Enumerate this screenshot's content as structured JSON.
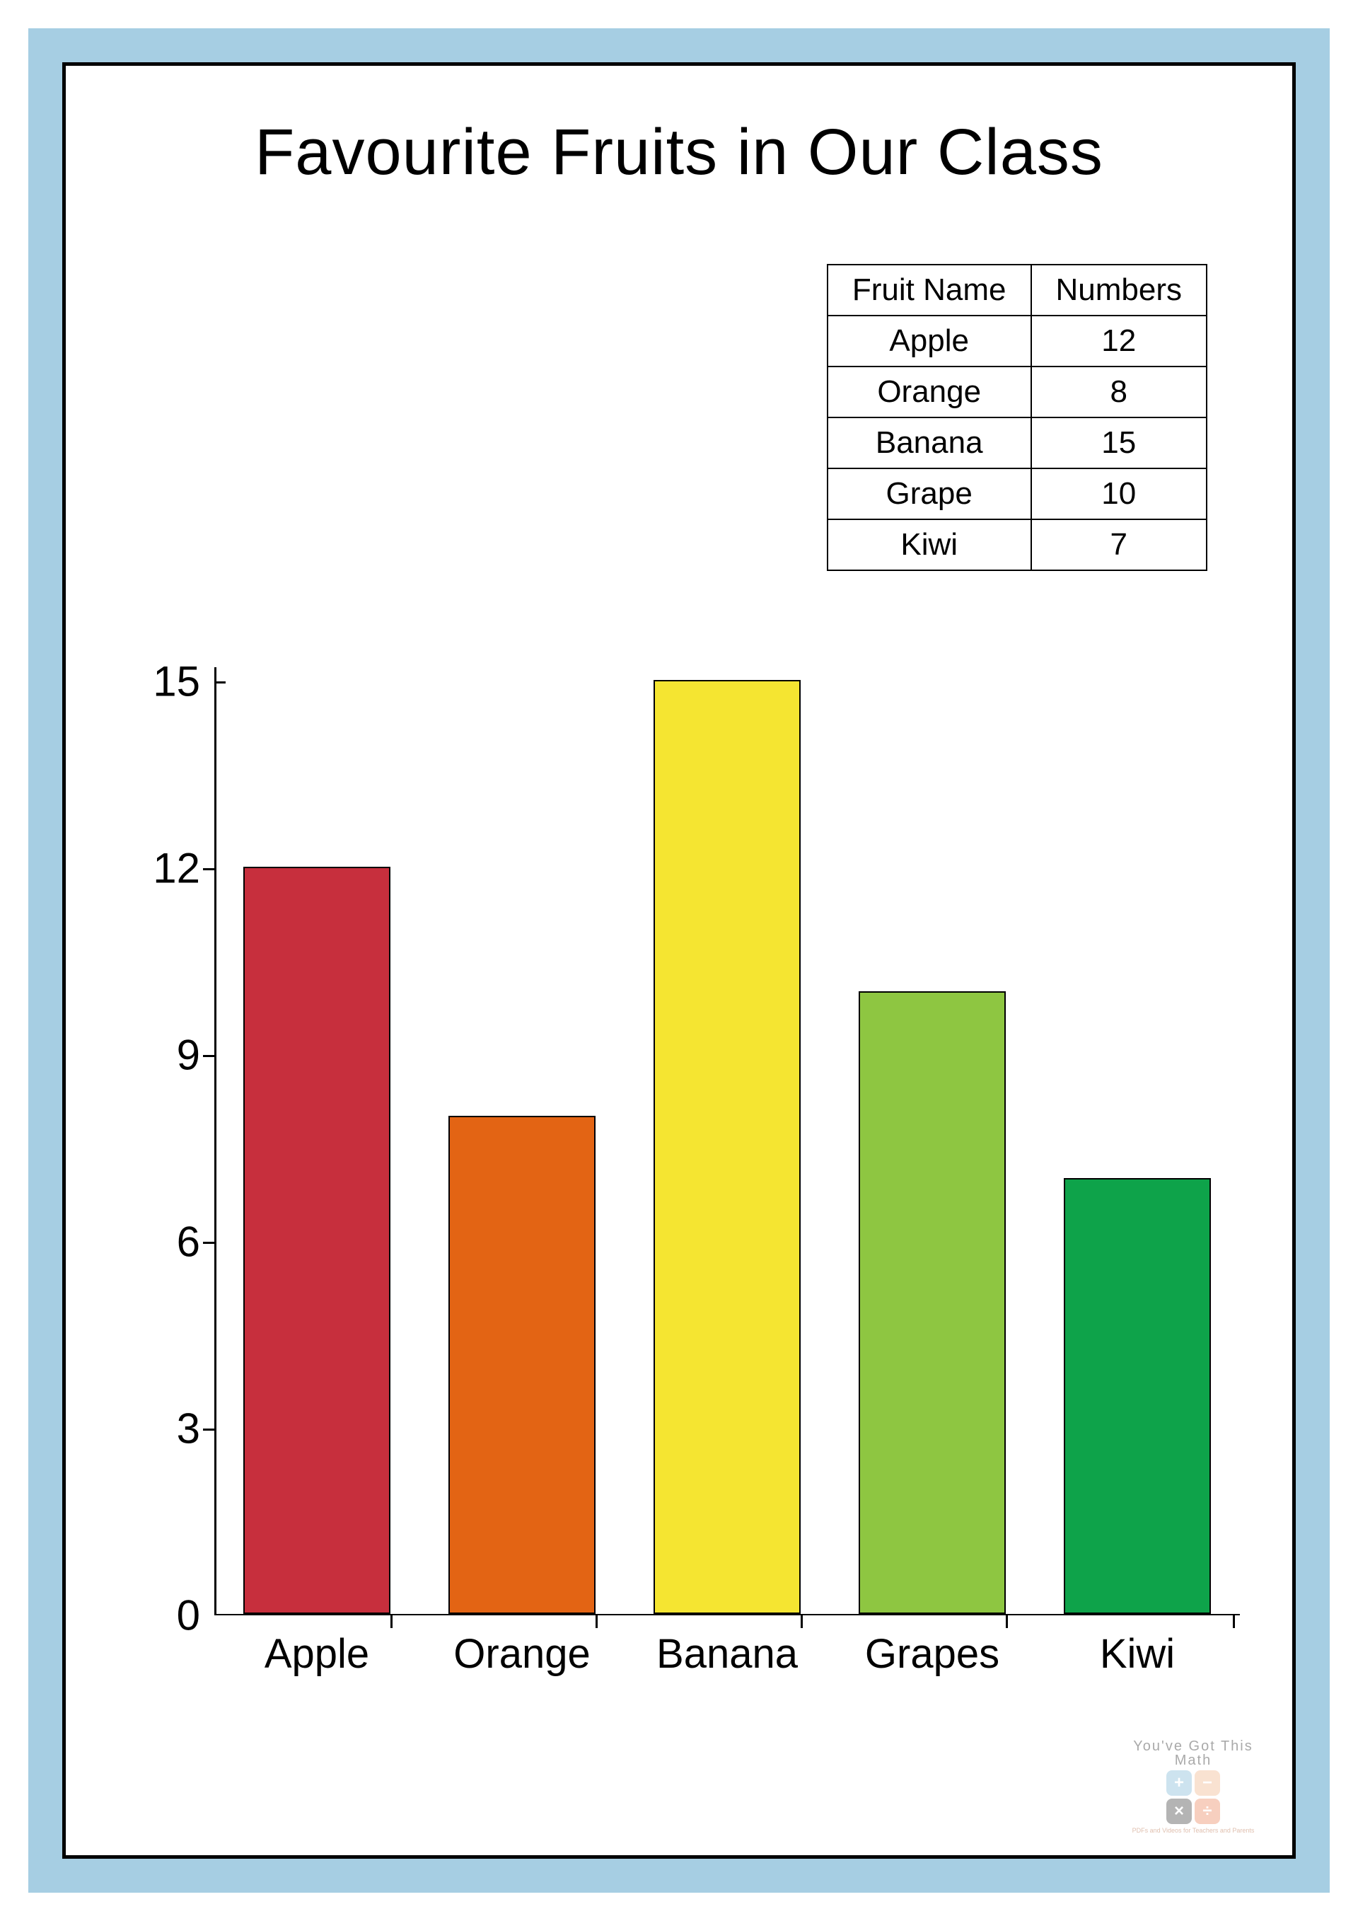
{
  "chart_data": {
    "type": "bar",
    "title": "Favourite Fruits in Our Class",
    "categories": [
      "Apple",
      "Orange",
      "Banana",
      "Grapes",
      "Kiwi"
    ],
    "values": [
      12,
      8,
      15,
      10,
      7
    ],
    "colors": [
      "#c72f3d",
      "#e36414",
      "#f5e531",
      "#8ec641",
      "#0ea34a"
    ],
    "y_ticks": [
      0,
      3,
      6,
      9,
      12,
      15
    ],
    "ylim": [
      0,
      15
    ]
  },
  "table": {
    "headers": [
      "Fruit Name",
      "Numbers"
    ],
    "rows": [
      [
        "Apple",
        "12"
      ],
      [
        "Orange",
        "8"
      ],
      [
        "Banana",
        "15"
      ],
      [
        "Grape",
        "10"
      ],
      [
        "Kiwi",
        "7"
      ]
    ]
  },
  "logo": {
    "text_top": "You've Got This",
    "text_right": "Math",
    "sub": "PDFs and Videos for Teachers and Parents"
  }
}
